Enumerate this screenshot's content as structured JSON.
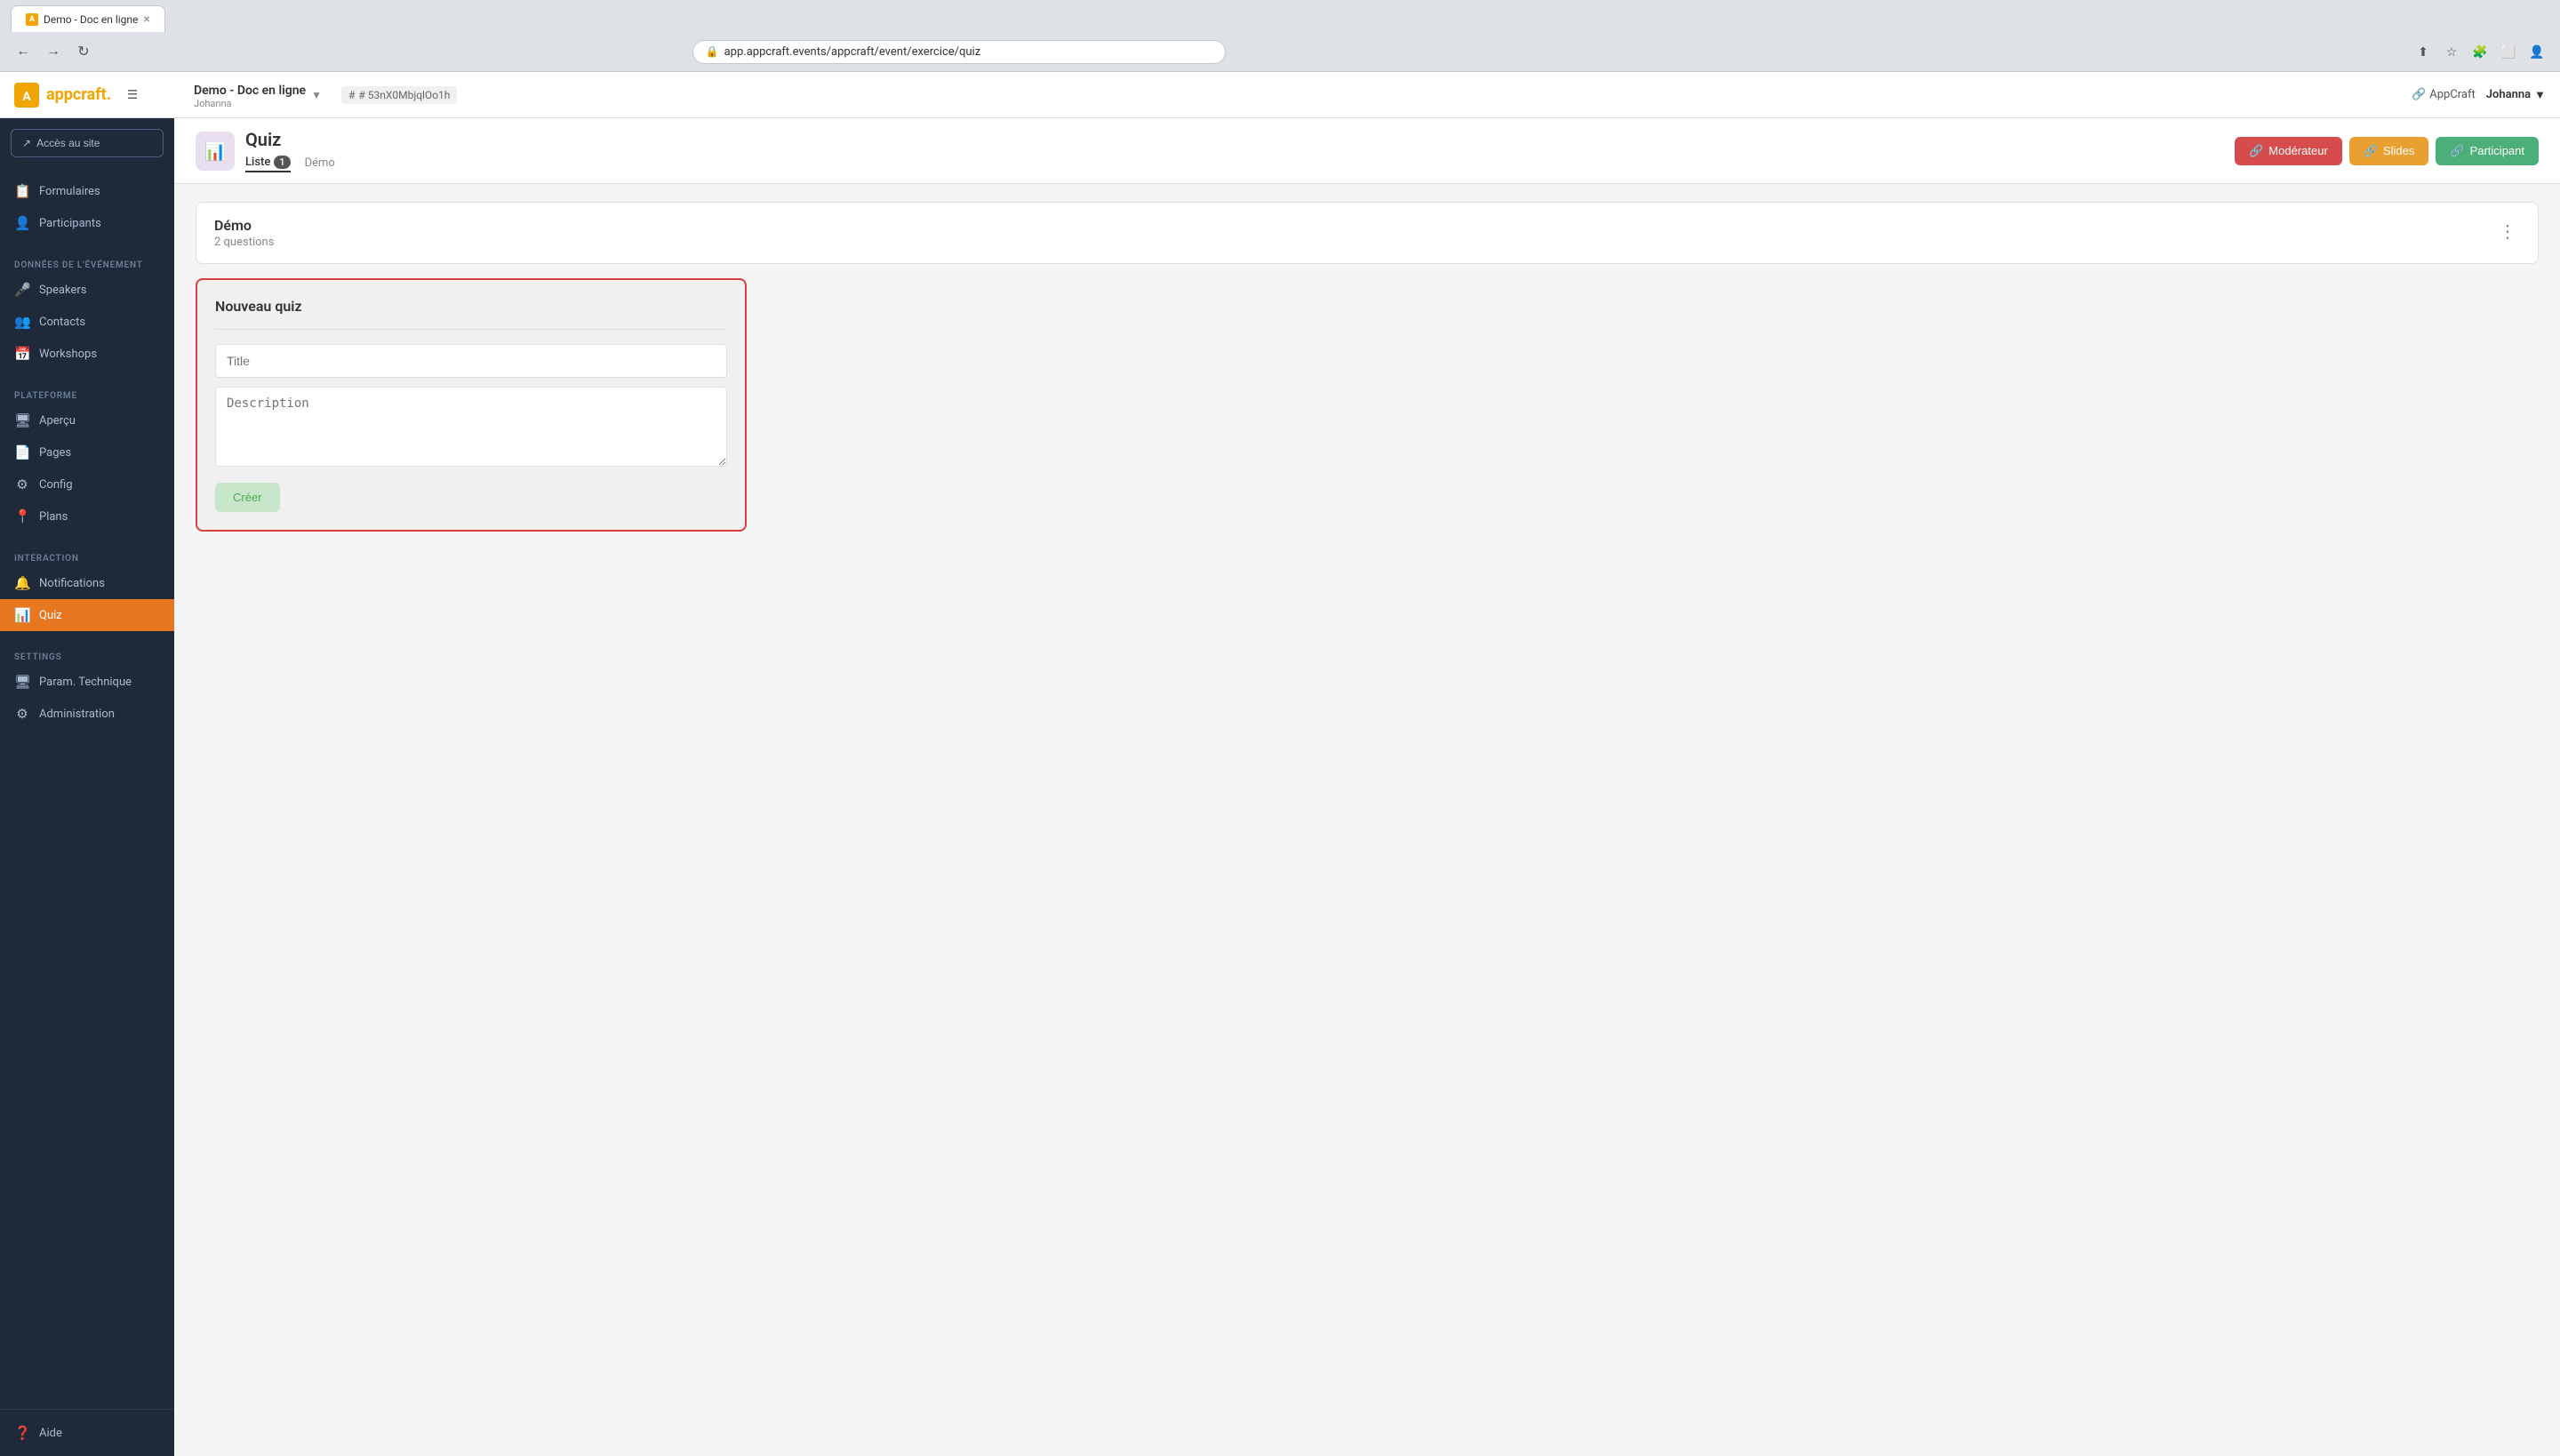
{
  "browser": {
    "url": "app.appcraft.events/appcraft/event/exercice/quiz",
    "tab_title": "Demo - Doc en ligne",
    "tab_favicon": "A"
  },
  "header": {
    "logo": "appcraft.",
    "hamburger_label": "☰",
    "event_name": "Demo - Doc en ligne",
    "event_user": "Johanna",
    "event_id": "# 53nX0MbjqlOo1h",
    "appcraft_link": "AppCraft",
    "user_name": "Johanna"
  },
  "sidebar": {
    "access_btn": "Accès au site",
    "sections": [
      {
        "items": [
          {
            "icon": "📋",
            "label": "Formulaires"
          },
          {
            "icon": "👤",
            "label": "Participants"
          }
        ]
      },
      {
        "label": "DONNÉES DE L'ÉVÉNEMENT",
        "items": [
          {
            "icon": "🎤",
            "label": "Speakers"
          },
          {
            "icon": "👥",
            "label": "Contacts"
          },
          {
            "icon": "📅",
            "label": "Workshops"
          }
        ]
      },
      {
        "label": "PLATEFORME",
        "items": [
          {
            "icon": "🖥",
            "label": "Aperçu"
          },
          {
            "icon": "📄",
            "label": "Pages"
          },
          {
            "icon": "⚙",
            "label": "Config"
          },
          {
            "icon": "📍",
            "label": "Plans"
          }
        ]
      },
      {
        "label": "INTERACTION",
        "items": [
          {
            "icon": "🔔",
            "label": "Notifications"
          },
          {
            "icon": "📊",
            "label": "Quiz",
            "active": true
          }
        ]
      },
      {
        "label": "SETTINGS",
        "items": [
          {
            "icon": "🖥",
            "label": "Param. Technique"
          },
          {
            "icon": "⚙",
            "label": "Administration"
          }
        ]
      }
    ],
    "bottom_item": {
      "icon": "❓",
      "label": "Aide"
    }
  },
  "page": {
    "icon": "📊",
    "title": "Quiz",
    "tabs": [
      {
        "label": "Liste",
        "badge": "1",
        "active": true
      },
      {
        "label": "Démo",
        "active": false
      }
    ],
    "actions": {
      "moderator": "Modérateur",
      "slides": "Slides",
      "participant": "Participant"
    }
  },
  "demo_card": {
    "title": "Démo",
    "subtitle": "2 questions",
    "more_icon": "⋮"
  },
  "new_quiz_form": {
    "title": "Nouveau quiz",
    "title_placeholder": "Title",
    "description_placeholder": "Description",
    "create_btn": "Créer"
  }
}
